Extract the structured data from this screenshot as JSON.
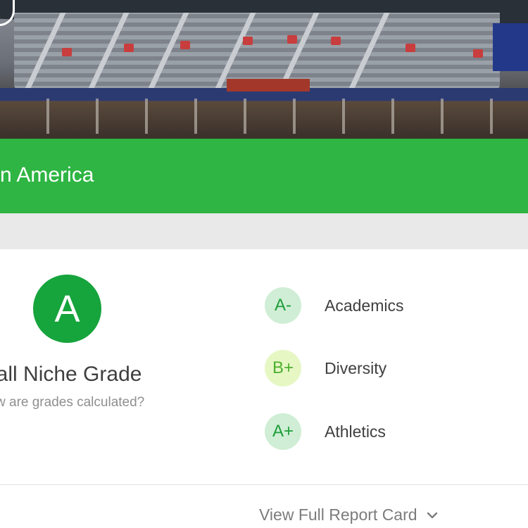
{
  "banner": {
    "title": "n America"
  },
  "overall": {
    "grade": "A",
    "label": "erall Niche Grade",
    "calc_link": "w are grades calculated?"
  },
  "grades": [
    {
      "grade": "A-",
      "label": "Academics",
      "bg": "#cfeed5",
      "fg": "#1f9e3a"
    },
    {
      "grade": "B+",
      "label": "Diversity",
      "bg": "#e6f7c4",
      "fg": "#4cb030"
    },
    {
      "grade": "A+",
      "label": "Athletics",
      "bg": "#cfeed5",
      "fg": "#1f9e3a"
    }
  ],
  "report_card": {
    "label": "View Full Report Card",
    "icon": "chevron-down-icon"
  },
  "colors": {
    "brand_green": "#2eb543",
    "grade_a": "#16a43c"
  }
}
